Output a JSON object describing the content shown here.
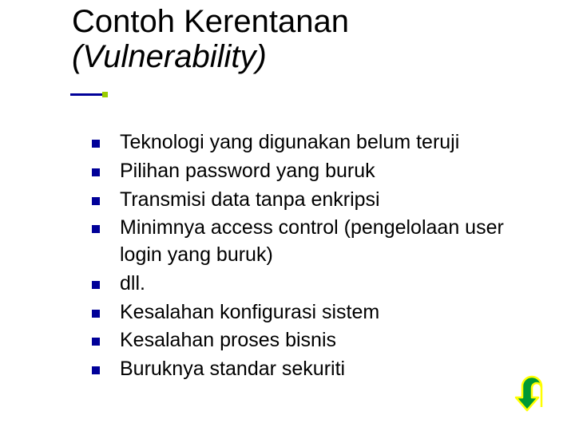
{
  "title": {
    "line1": "Contoh Kerentanan",
    "line2": "(Vulnerability)"
  },
  "bullets": [
    "Teknologi yang digunakan belum teruji",
    "Pilihan password yang buruk",
    "Transmisi data tanpa enkripsi",
    "Minimnya access control (pengelolaan user login yang buruk)",
    "dll.",
    "Kesalahan konfigurasi sistem",
    "Kesalahan proses bisnis",
    "Buruknya standar sekuriti"
  ],
  "icons": {
    "back": "u-turn-back-icon"
  },
  "colors": {
    "bullet": "#000099",
    "accent_dot": "#99cc00",
    "button_fill": "#009933",
    "button_stroke": "#ffff00"
  }
}
